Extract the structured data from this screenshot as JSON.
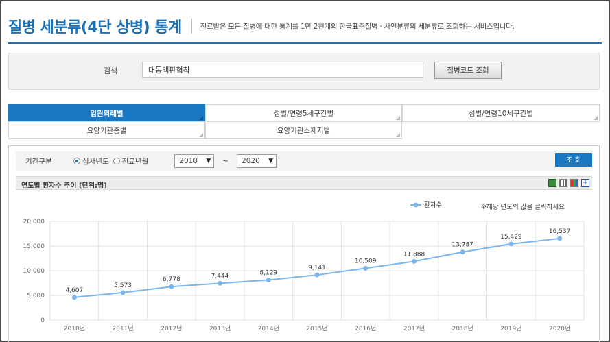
{
  "header": {
    "title": "질병 세분류(4단 상병) 통계",
    "description": "진료받은 모든 질병에 대한 통계를 1만 2천개의 한국표준질병 · 사인분류의 세분류로 조회하는 서비스입니다."
  },
  "search": {
    "label": "검색",
    "value": "대동맥판협착",
    "button_label": "질병코드 조회"
  },
  "tabs": [
    {
      "label": "입원외래별",
      "active": true
    },
    {
      "label": "성별/연령5세구간별",
      "active": false
    },
    {
      "label": "성별/연령10세구간별",
      "active": false
    },
    {
      "label": "요양기관종별",
      "active": false
    },
    {
      "label": "요양기관소재지별",
      "active": false
    }
  ],
  "filter": {
    "label": "기간구분",
    "radio_1": "심사년도",
    "radio_2": "진료년월",
    "from": "2010",
    "to": "2020",
    "tilde": "~",
    "query_button": "조 회"
  },
  "chart_header": {
    "title": "연도별 환자수 추이 [단위:명]"
  },
  "chart_data": {
    "type": "line",
    "x": [
      "2010년",
      "2011년",
      "2012년",
      "2013년",
      "2014년",
      "2015년",
      "2016년",
      "2017년",
      "2018년",
      "2019년",
      "2020년"
    ],
    "series": [
      {
        "name": "환자수",
        "values": [
          4607,
          5573,
          6778,
          7444,
          8129,
          9141,
          10509,
          11888,
          13787,
          15429,
          16537
        ],
        "color": "#7cb5ec"
      }
    ],
    "y_ticks": [
      "0",
      "5,000",
      "10,000",
      "15,000",
      "20,000"
    ],
    "ylim": [
      0,
      20000
    ],
    "grid": true,
    "legend": "top-right",
    "note": "※해당 년도의 값을 클릭하세요"
  },
  "colors": {
    "accent": "#1a6fb5",
    "active_tab": "#1a78c2",
    "line": "#7cb5ec"
  }
}
